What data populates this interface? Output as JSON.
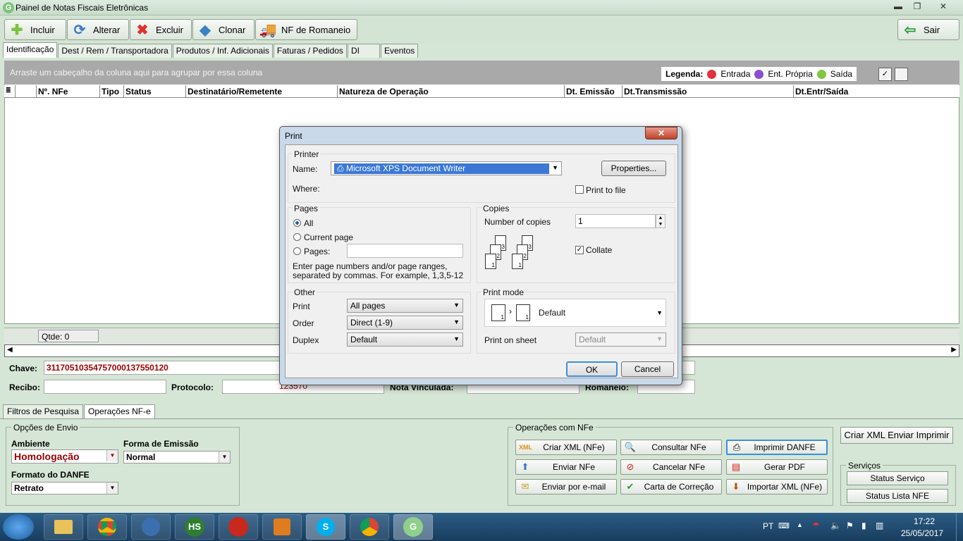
{
  "window": {
    "title": "Painel de Notas Fiscais Eletrônicas",
    "app_icon": "G",
    "controls": {
      "minimize": "▬",
      "maximize": "❐",
      "close": "✕"
    }
  },
  "toolbar": {
    "incluir": "Incluir",
    "alterar": "Alterar",
    "excluir": "Excluir",
    "clonar": "Clonar",
    "nf_romaneio": "NF de Romaneio",
    "sair": "Sair"
  },
  "tabs": [
    "Identificação",
    "Dest / Rem / Transportadora",
    "Produtos / Inf. Adicionais",
    "Faturas / Pedidos",
    "DI",
    "Eventos"
  ],
  "grid": {
    "group_hint": "Arraste um cabeçalho da coluna aqui para agrupar por essa coluna",
    "legend_title": "Legenda:",
    "legend": [
      {
        "label": "Entrada",
        "color": "#e0323a"
      },
      {
        "label": "Ent. Própria",
        "color": "#8a4fd1"
      },
      {
        "label": "Saída",
        "color": "#7fc83f"
      }
    ],
    "columns": [
      "Nº. NFe",
      "Tipo",
      "Status",
      "Destinatário/Remetente",
      "Natureza de Operação",
      "Dt. Emissão",
      "Dt.Transmissão",
      "Dt.Entr/Saída"
    ],
    "qtde": "Qtde: 0"
  },
  "fields": {
    "chave_label": "Chave:",
    "chave_value": "31170510354757000137550120",
    "recibo_label": "Recibo:",
    "protocolo_label": "Protocolo:",
    "nota_vinculada_label": "Nota Vinculada:",
    "romaneio_label": "Romaneio:",
    "partial_value": "123570"
  },
  "bottom_tabs": [
    "Filtros de Pesquisa",
    "Operações NF-e"
  ],
  "opcoes_envio": {
    "title": "Opções de Envio",
    "ambiente_label": "Ambiente",
    "ambiente_value": "Homologação",
    "forma_label": "Forma de Emissão",
    "forma_value": "Normal",
    "formato_label": "Formato do DANFE",
    "formato_value": "Retrato"
  },
  "operacoes": {
    "title": "Operações com NFe",
    "buttons": [
      {
        "label": "Criar XML (NFe)",
        "icon": "xml-icon"
      },
      {
        "label": "Consultar NFe",
        "icon": "search-icon"
      },
      {
        "label": "Imprimir DANFE",
        "icon": "printer-icon"
      },
      {
        "label": "Enviar NFe",
        "icon": "upload-arrow-icon"
      },
      {
        "label": "Cancelar NFe",
        "icon": "cancel-icon"
      },
      {
        "label": "Gerar PDF",
        "icon": "pdf-icon"
      },
      {
        "label": "Enviar por e-mail",
        "icon": "email-icon"
      },
      {
        "label": "Carta de Correção",
        "icon": "check-icon"
      },
      {
        "label": "Importar XML (NFe)",
        "icon": "download-arrow-icon"
      }
    ]
  },
  "criar_xml_enviar_imprimir": "Criar XML Enviar Imprimir",
  "servicos": {
    "title": "Serviços",
    "status_servico": "Status Serviço",
    "status_lista": "Status Lista NFE"
  },
  "print_dialog": {
    "title": "Print",
    "close": "✕",
    "printer_group": "Printer",
    "name_label": "Name:",
    "printer_name": "Microsoft XPS Document Writer",
    "where_label": "Where:",
    "properties": "Properties...",
    "print_to_file": "Print to file",
    "pages_group": "Pages",
    "all": "All",
    "current_page": "Current page",
    "pages": "Pages:",
    "pages_hint_1": "Enter page numbers and/or page ranges,",
    "pages_hint_2": "separated by commas. For example, 1,3,5-12",
    "copies_group": "Copies",
    "number_of_copies": "Number of copies",
    "copies_value": "1",
    "collate": "Collate",
    "other_group": "Other",
    "print_label": "Print",
    "print_value": "All pages",
    "order_label": "Order",
    "order_value": "Direct (1-9)",
    "duplex_label": "Duplex",
    "duplex_value": "Default",
    "print_mode_group": "Print mode",
    "print_mode_value": "Default",
    "print_on_sheet": "Print on sheet",
    "print_on_sheet_value": "Default",
    "ok": "OK",
    "cancel": "Cancel"
  },
  "taskbar": {
    "lang": "PT",
    "time": "17:22",
    "date": "25/05/2017",
    "apps": [
      "explorer",
      "chrome",
      "thunderbird",
      "hs",
      "app-red",
      "media-player",
      "skype",
      "chrome",
      "g-app"
    ]
  }
}
